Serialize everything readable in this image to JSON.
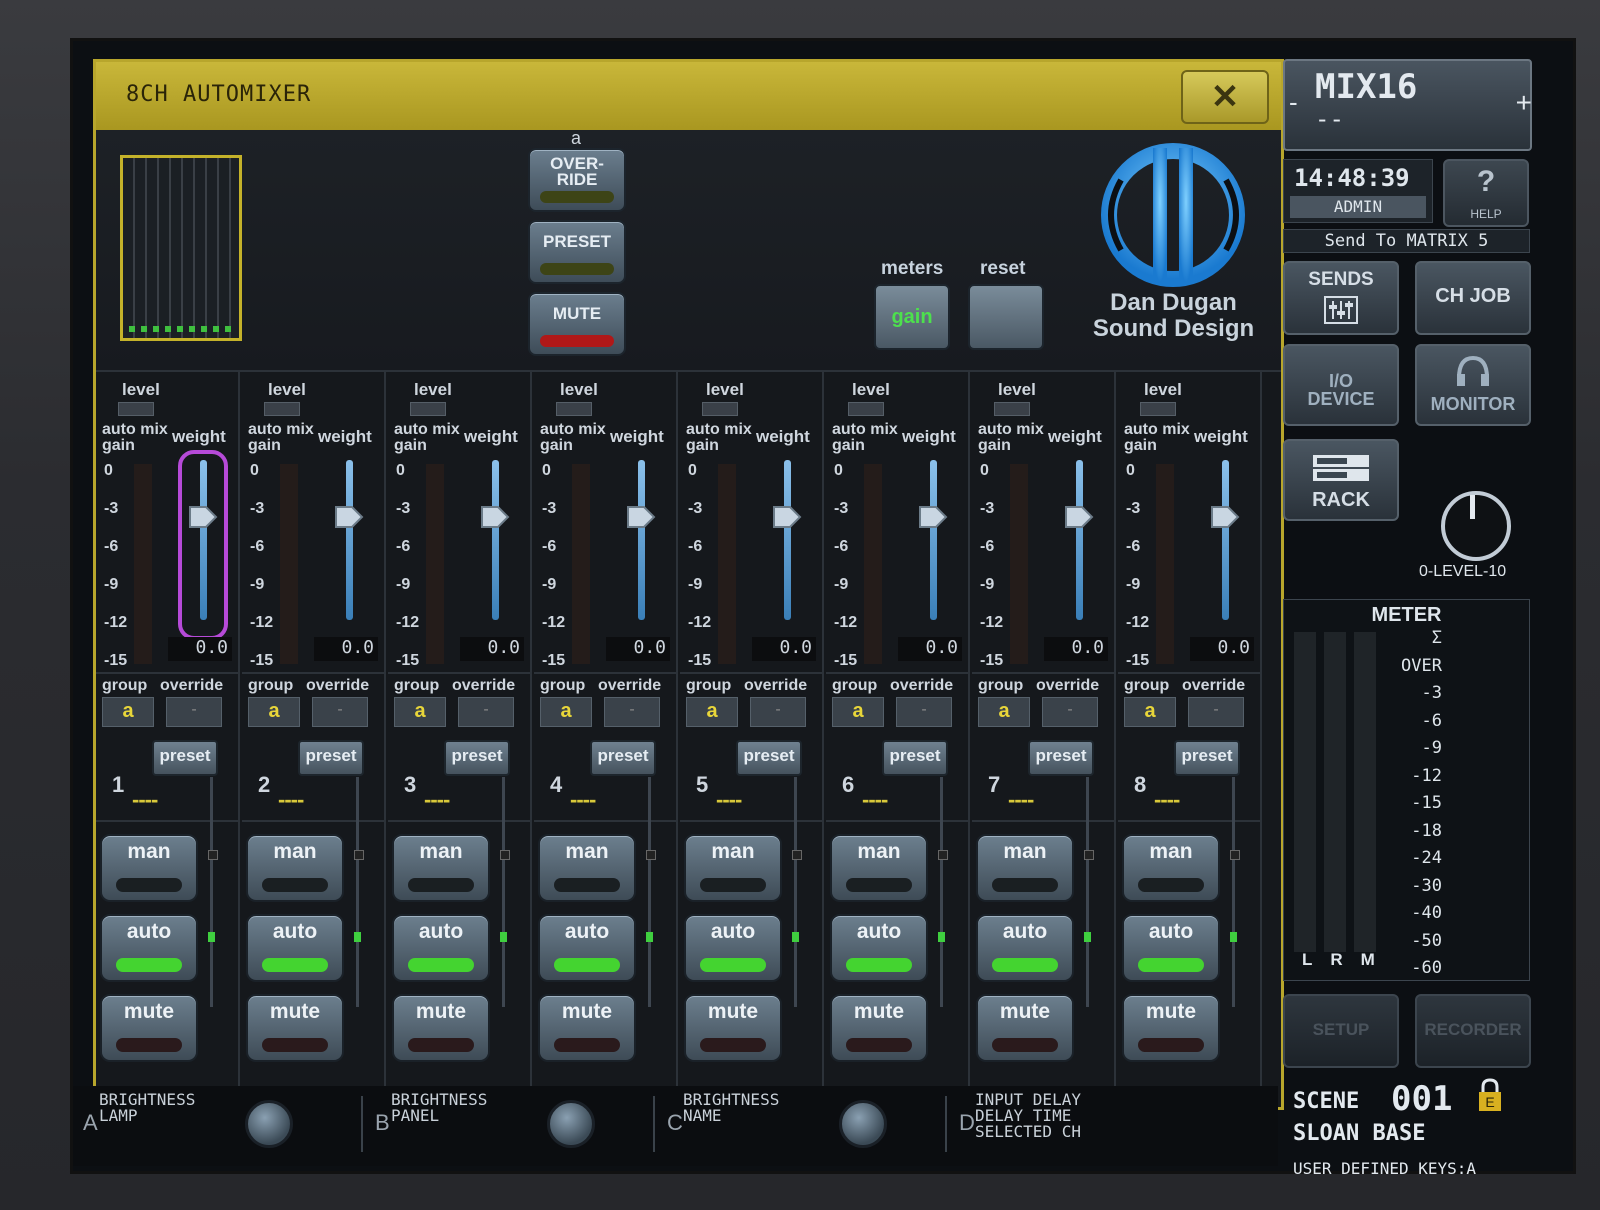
{
  "window": {
    "title": "8CH AUTOMIXER",
    "close_symbol": "✕"
  },
  "top": {
    "group_letter": "a",
    "override_label": "OVER-\nRIDE",
    "preset_label": "PRESET",
    "mute_label": "MUTE",
    "meters_label": "meters",
    "meters_button": "gain",
    "reset_label": "reset",
    "logo_name_line1": "Dan Dugan",
    "logo_name_line2": "Sound Design"
  },
  "strip_labels": {
    "level": "level",
    "auto_mix_gain": "auto mix\ngain",
    "weight": "weight",
    "group": "group",
    "override": "override",
    "preset": "preset",
    "man": "man",
    "auto": "auto",
    "mute": "mute",
    "dash": "----",
    "override_value": "-"
  },
  "scale": [
    "0",
    "-3",
    "-6",
    "-9",
    "-12",
    "-15"
  ],
  "channels": [
    {
      "num": "1",
      "weight": "0.0",
      "group": "a",
      "selected": true
    },
    {
      "num": "2",
      "weight": "0.0",
      "group": "a",
      "selected": false
    },
    {
      "num": "3",
      "weight": "0.0",
      "group": "a",
      "selected": false
    },
    {
      "num": "4",
      "weight": "0.0",
      "group": "a",
      "selected": false
    },
    {
      "num": "5",
      "weight": "0.0",
      "group": "a",
      "selected": false
    },
    {
      "num": "6",
      "weight": "0.0",
      "group": "a",
      "selected": false
    },
    {
      "num": "7",
      "weight": "0.0",
      "group": "a",
      "selected": false
    },
    {
      "num": "8",
      "weight": "0.0",
      "group": "a",
      "selected": false
    }
  ],
  "encoders": [
    {
      "letter": "A",
      "text": "BRIGHTNESS\nLAMP"
    },
    {
      "letter": "B",
      "text": "BRIGHTNESS\nPANEL"
    },
    {
      "letter": "C",
      "text": "BRIGHTNESS\nNAME"
    },
    {
      "letter": "D",
      "text": "INPUT DELAY\nDELAY TIME\nSELECTED CH"
    }
  ],
  "right": {
    "mix": "MIX16",
    "mix_dash": "--",
    "minus": "-",
    "plus": "+",
    "time": "14:48:39",
    "user": "ADMIN",
    "help_q": "?",
    "help": "HELP",
    "send_to": "Send To MATRIX 5",
    "sends": "SENDS",
    "ch_job": "CH JOB",
    "io_device": "I/O\nDEVICE",
    "monitor": "MONITOR",
    "rack": "RACK",
    "level_label": "0-LEVEL-10",
    "meter_title": "METER",
    "meter_scale": [
      "Σ",
      "OVER",
      "-3",
      "-6",
      "-9",
      "-12",
      "-15",
      "-18",
      "-24",
      "-30",
      "-40",
      "-50",
      "-60"
    ],
    "lrm": "LRM",
    "setup": "SETUP",
    "recorder": "RECORDER",
    "scene_label": "SCENE",
    "scene_num": "001",
    "scene_lock": "E",
    "scene_name": "SLOAN BASE",
    "user_keys": "USER DEFINED KEYS:A"
  },
  "colors": {
    "accent_yellow": "#c9b73a",
    "lamp_green": "#44d430",
    "mute_red": "#c02020",
    "select_purple": "#b64ad8"
  }
}
